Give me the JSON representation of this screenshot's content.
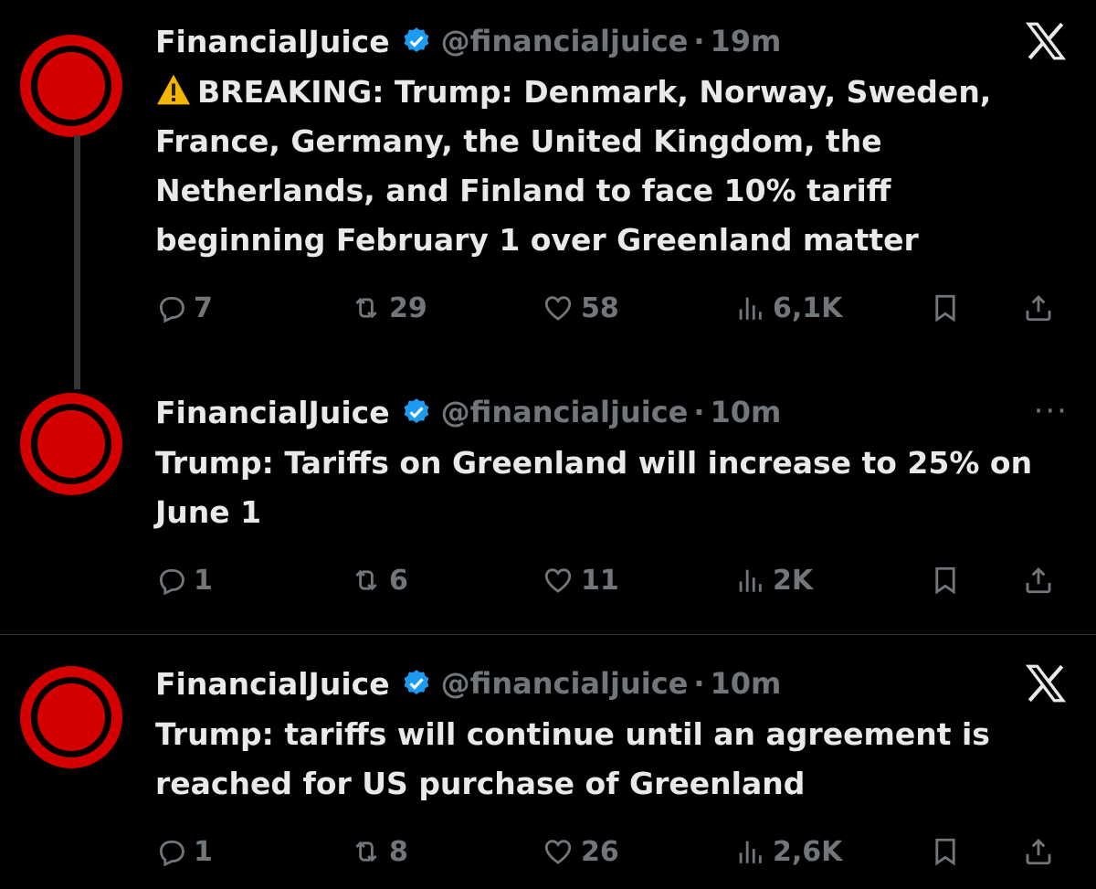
{
  "accent": "#1d9bf0",
  "avatar_color": "#d40000",
  "tweets": [
    {
      "name": "FinancialJuice",
      "handle": "@financialjuice",
      "separator": "·",
      "time": "19m",
      "corner_icon": "x-logo-icon",
      "text_prefix_icon": "warning-icon",
      "text": "BREAKING: Trump: Denmark, Norway, Sweden, France, Germany, the United Kingdom, the Netherlands, and Finland to face 10% tariff beginning February 1 over Greenland matter",
      "replies": "7",
      "reposts": "29",
      "likes": "58",
      "views": "6,1K"
    },
    {
      "name": "FinancialJuice",
      "handle": "@financialjuice",
      "separator": "·",
      "time": "10m",
      "corner_icon": "more-icon",
      "more_label": "···",
      "text": "Trump: Tariffs on Greenland will increase to 25% on June 1",
      "replies": "1",
      "reposts": "6",
      "likes": "11",
      "views": "2K"
    },
    {
      "name": "FinancialJuice",
      "handle": "@financialjuice",
      "separator": "·",
      "time": "10m",
      "corner_icon": "x-logo-icon",
      "text": "Trump: tariffs will continue until an agreement is reached for US purchase of Greenland",
      "replies": "1",
      "reposts": "8",
      "likes": "26",
      "views": "2,6K"
    }
  ]
}
